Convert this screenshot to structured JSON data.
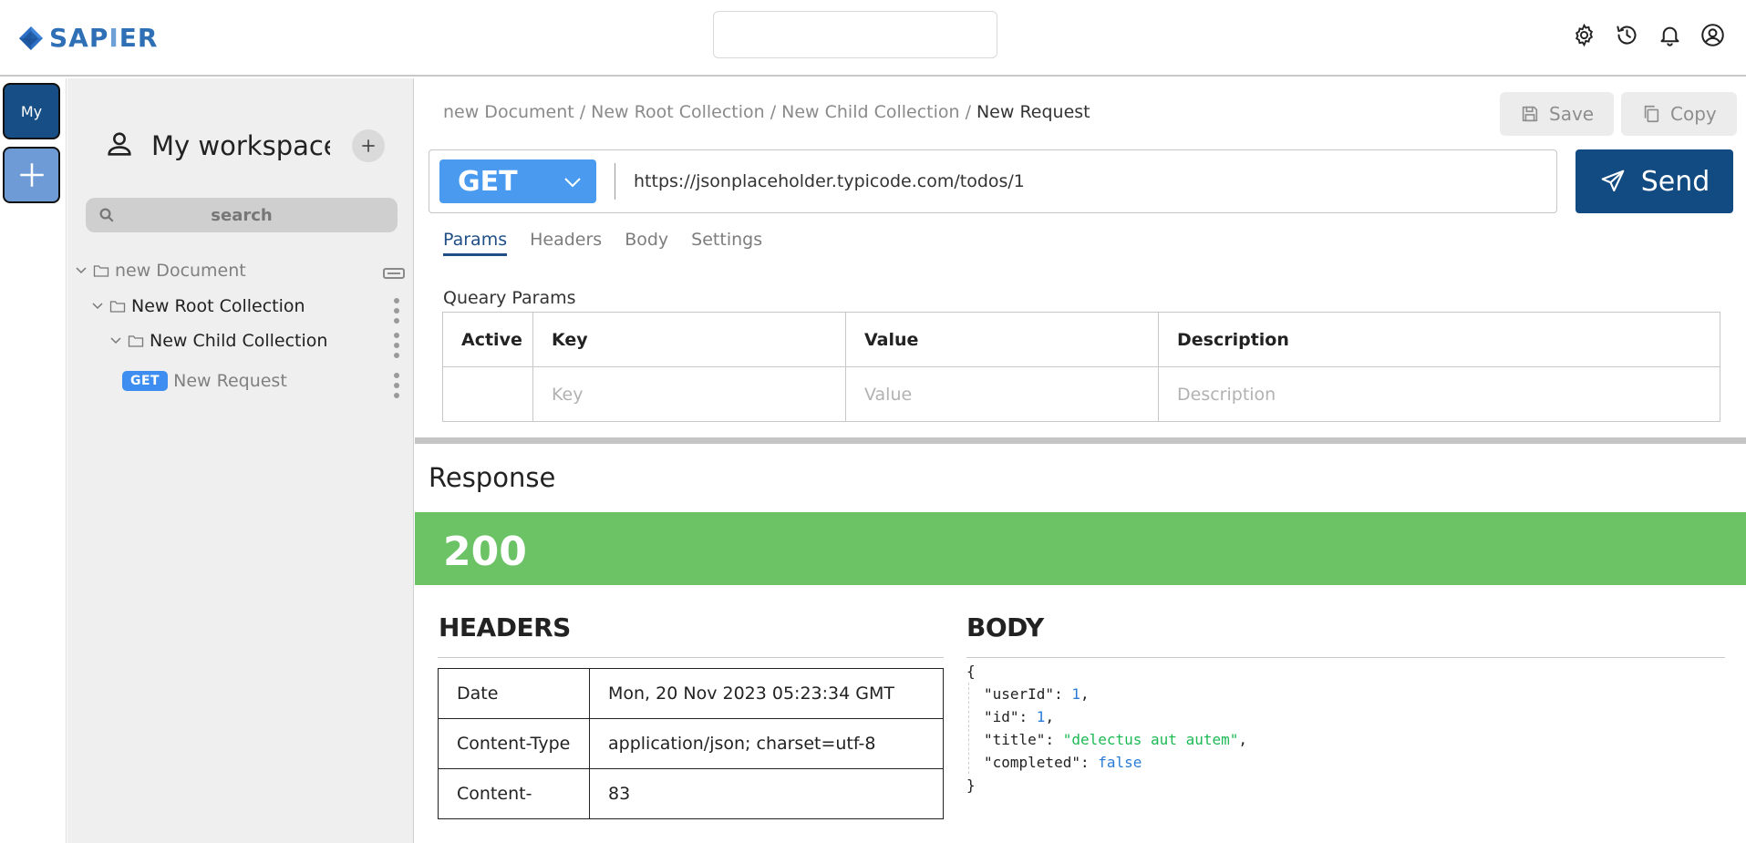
{
  "app": {
    "name_part1": "SAP",
    "name_part2": "I",
    "name_part3": "ER",
    "icons": [
      "settings-icon",
      "history-icon",
      "bell-icon",
      "account-icon"
    ]
  },
  "rail": {
    "my_label": "My",
    "add_icon": "plus-icon"
  },
  "sidebar": {
    "workspace_title": "My workspace",
    "search_placeholder": "search",
    "tree": [
      {
        "label": "new Document",
        "type": "document"
      },
      {
        "label": "New Root Collection",
        "type": "collection"
      },
      {
        "label": "New Child Collection",
        "type": "collection"
      },
      {
        "label": "New Request",
        "type": "request",
        "method": "GET"
      }
    ]
  },
  "breadcrumb": {
    "items": [
      "new Document",
      "New Root Collection",
      "New Child Collection"
    ],
    "separator": "/",
    "current": "New Request"
  },
  "toolbar": {
    "save_label": "Save",
    "copy_label": "Copy"
  },
  "request": {
    "method": "GET",
    "url": "https://jsonplaceholder.typicode.com/todos/1",
    "send_label": "Send"
  },
  "tabs": [
    {
      "label": "Params",
      "active": true
    },
    {
      "label": "Headers",
      "active": false
    },
    {
      "label": "Body",
      "active": false
    },
    {
      "label": "Settings",
      "active": false
    }
  ],
  "params": {
    "section_label": "Queary Params",
    "columns": [
      "Active",
      "Key",
      "Value",
      "Description"
    ],
    "placeholders": {
      "key": "Key",
      "value": "Value",
      "description": "Description"
    }
  },
  "response": {
    "title": "Response",
    "status_code": "200",
    "status_color": "#6cc366",
    "headers_title": "HEADERS",
    "body_title": "BODY",
    "headers": [
      {
        "key": "Date",
        "value": "Mon, 20 Nov 2023 05:23:34 GMT"
      },
      {
        "key": "Content-Type",
        "value": "application/json; charset=utf-8"
      },
      {
        "key": "Content-",
        "value": "83"
      }
    ],
    "body": {
      "open": "{",
      "close": "}",
      "lines": [
        {
          "key": "\"userId\"",
          "value": "1",
          "kind": "num",
          "comma": ","
        },
        {
          "key": "\"id\"",
          "value": "1",
          "kind": "num",
          "comma": ","
        },
        {
          "key": "\"title\"",
          "value": "\"delectus aut autem\"",
          "kind": "str",
          "comma": ","
        },
        {
          "key": "\"completed\"",
          "value": "false",
          "kind": "bool",
          "comma": ""
        }
      ]
    }
  },
  "colors": {
    "brand_dark": "#124a82",
    "method_blue": "#4a9bf0",
    "success_green": "#6cc366"
  }
}
